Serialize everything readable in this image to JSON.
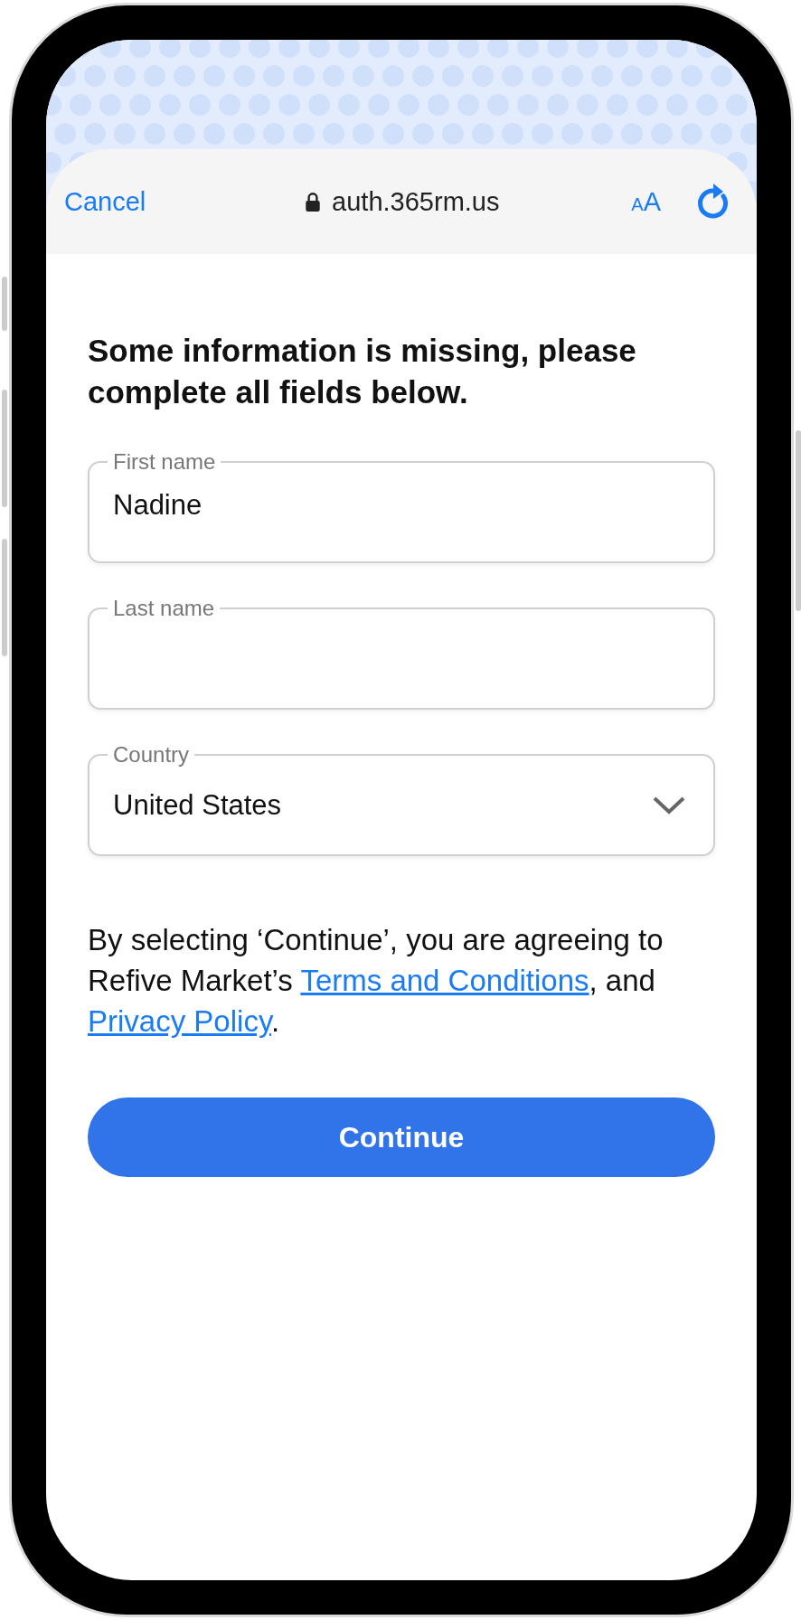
{
  "browser_bar": {
    "cancel": "Cancel",
    "url": "auth.365rm.us",
    "text_size": "AA"
  },
  "heading": "Some information is missing, please complete all fields below.",
  "fields": [
    {
      "kind": "text",
      "label": "First name",
      "value": "Nadine"
    },
    {
      "kind": "text",
      "label": "Last name"
    },
    {
      "kind": "select",
      "label": "Country",
      "value": "United States"
    }
  ],
  "legal": [
    {
      "kind": "text",
      "text": "By selecting ‘Continue’, you are agreeing to Refive Market’s "
    },
    {
      "kind": "link",
      "text": "Terms and Conditions"
    },
    {
      "kind": "text",
      "text": ", and "
    },
    {
      "kind": "link",
      "text": "Privacy Policy"
    },
    {
      "kind": "text",
      "text": "."
    }
  ],
  "button": "Continue"
}
